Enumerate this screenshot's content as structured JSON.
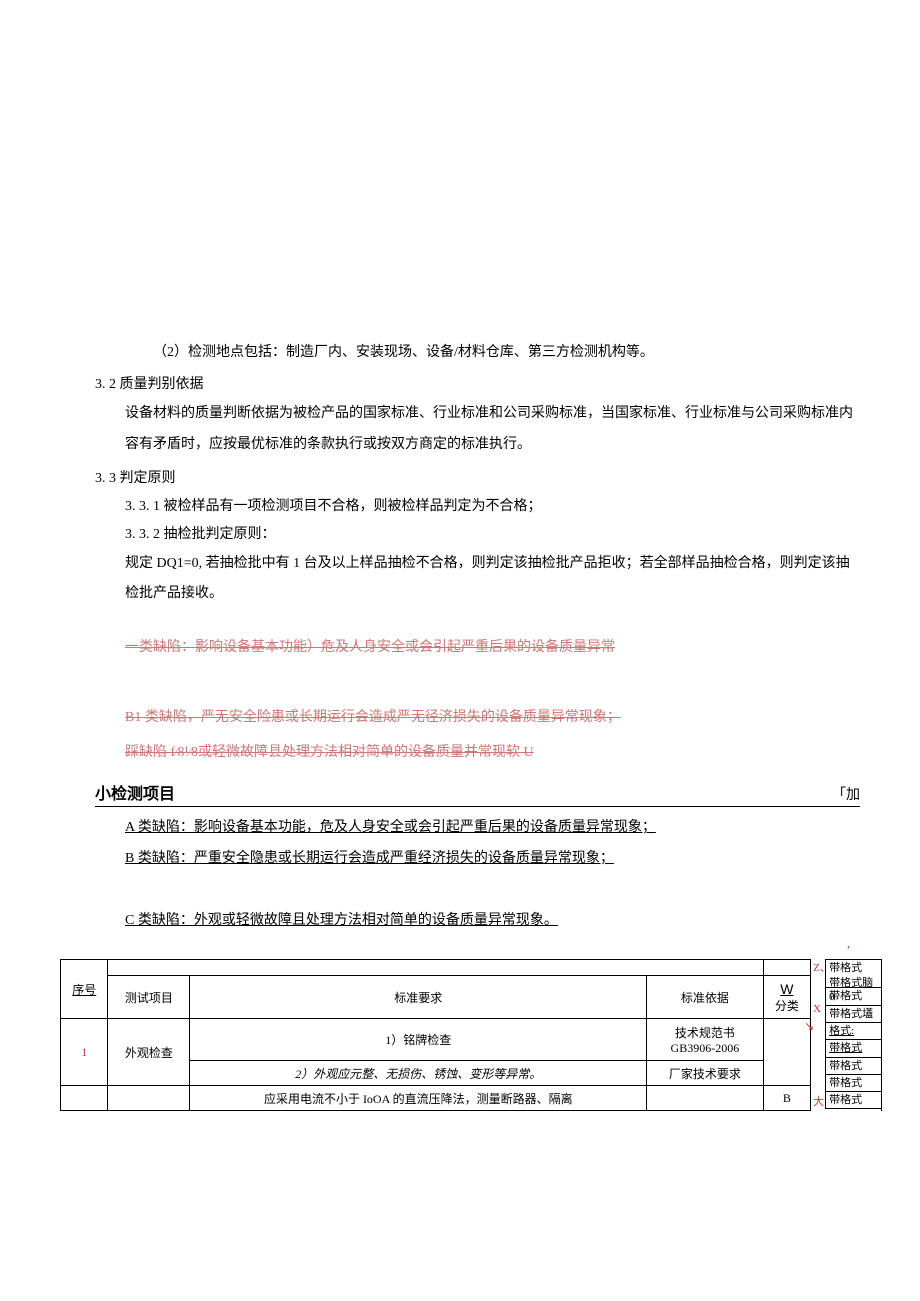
{
  "p1": "（2）检测地点包括：制造厂内、安装现场、设备/材料仓库、第三方检测机构等。",
  "h32": "3. 2 质量判别依据",
  "p32": "设备材料的质量判断依据为被检产品的国家标准、行业标准和公司采购标准，当国家标准、行业标准与公司采购标准内容有矛盾时，应按最优标准的条款执行或按双方商定的标准执行。",
  "h33": "3. 3 判定原则",
  "p331": "3. 3. 1 被检样品有一项检测项目不合格，则被检样品判定为不合格；",
  "p332": "3. 3. 2 抽检批判定原则：",
  "p333": "规定 DQ1=0, 若抽检批中有 1 台及以上样品抽检不合格，则判定该抽检批产品拒收；若全部样品抽检合格，则判定该抽检批产品接收。",
  "strike1": "一类缺陷：影响设备基本功能）危及人身安全或会引起严重后果的设备质量异常",
  "strike2": "B1 类缺陷，严无安全险患或长期运行会造成严无径济损失的设备质量异常现象；",
  "strike3": "踩缺陷 f⁄8¹⁄8或轻微故障县处理方法相对简单的设备质量并常现软 U",
  "sectionTitle": "小检测项目",
  "sectionTail": "「加",
  "defA": "A 类缺陷：影响设备基本功能，危及人身安全或会引起严重后果的设备质量异常现象；",
  "defB": "B 类缺陷：严重安全隐患或长期运行会造成严重经济损失的设备质量异常现象；",
  "defC": "C 类缺陷：外观或轻微故障且处理方法相对简单的设备质量异常现象。",
  "table": {
    "headers": {
      "seq": "序号",
      "item": "测试项目",
      "req": "标准要求",
      "basis": "标准依据",
      "cls": "分类",
      "w": "W"
    },
    "rows": [
      {
        "seq": "1",
        "item": "外观检查",
        "req1": "1）铭牌检查",
        "basis1": "技术规范书",
        "basis1b": "GB3906-2006",
        "req2": "2）外观应元整、无损伤、锈蚀、变形等异常。",
        "basis2": "厂家技术要求"
      },
      {
        "req": "应采用电流不小于 IoOA 的直流压降法，测量断路器、隔离",
        "cls": "B"
      }
    ]
  },
  "side": {
    "r0a": "带格式",
    "r0b": "带格式脑",
    "r0c": "0",
    "r1": "带格式",
    "r2": "带格式壒",
    "r3": "格式:",
    "r4": "带格式",
    "r5": "带格式",
    "r6": "带格式",
    "r7": "带格式"
  },
  "markers": {
    "z": "Z、",
    "x": "X",
    "dai": "大"
  }
}
